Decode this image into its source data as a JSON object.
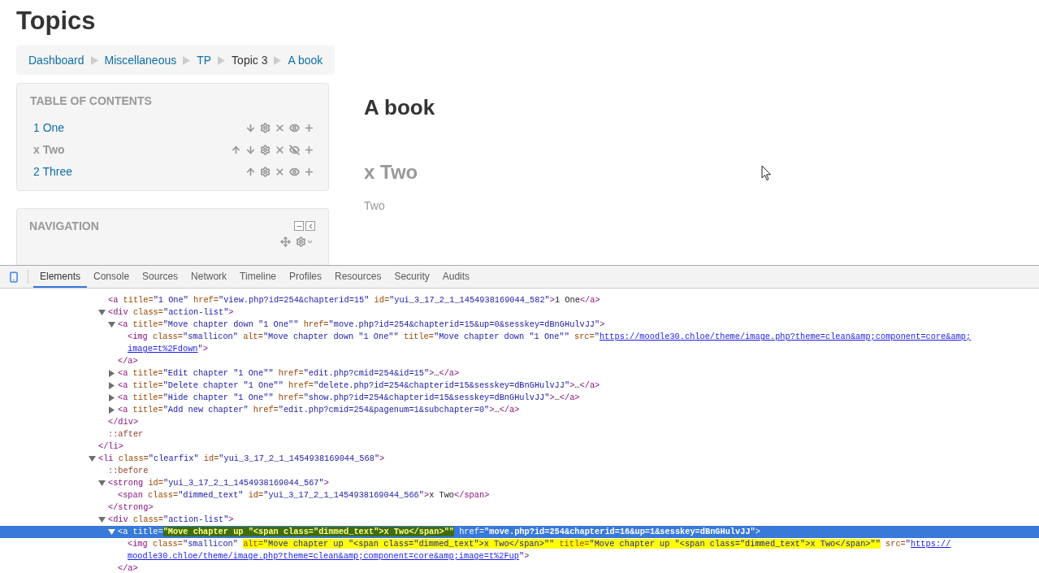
{
  "page": {
    "title": "Topics"
  },
  "breadcrumb": [
    {
      "label": "Dashboard",
      "link": true
    },
    {
      "label": "Miscellaneous",
      "link": true
    },
    {
      "label": "TP",
      "link": true
    },
    {
      "label": "Topic 3",
      "link": false
    },
    {
      "label": "A book",
      "link": true
    }
  ],
  "toc": {
    "title": "TABLE OF CONTENTS",
    "items": [
      {
        "label": "1 One",
        "hidden": false,
        "actions": [
          {
            "kind": "down"
          },
          {
            "kind": "edit"
          },
          {
            "kind": "delete"
          },
          {
            "kind": "hide"
          },
          {
            "kind": "add"
          }
        ]
      },
      {
        "label": "x Two",
        "hidden": true,
        "actions": [
          {
            "kind": "up"
          },
          {
            "kind": "down"
          },
          {
            "kind": "edit"
          },
          {
            "kind": "delete"
          },
          {
            "kind": "show"
          },
          {
            "kind": "add"
          }
        ]
      },
      {
        "label": "2 Three",
        "hidden": false,
        "actions": [
          {
            "kind": "up"
          },
          {
            "kind": "edit"
          },
          {
            "kind": "delete"
          },
          {
            "kind": "hide"
          },
          {
            "kind": "add"
          }
        ]
      }
    ]
  },
  "navigation": {
    "title": "NAVIGATION"
  },
  "content": {
    "book_title": "A book",
    "chapter_title": "x Two",
    "chapter_text": "Two"
  },
  "devtools": {
    "tabs": [
      {
        "label": "Elements",
        "selected": true
      },
      {
        "label": "Console",
        "selected": false
      },
      {
        "label": "Sources",
        "selected": false
      },
      {
        "label": "Network",
        "selected": false
      },
      {
        "label": "Timeline",
        "selected": false
      },
      {
        "label": "Profiles",
        "selected": false
      },
      {
        "label": "Resources",
        "selected": false
      },
      {
        "label": "Security",
        "selected": false
      },
      {
        "label": "Audits",
        "selected": false
      }
    ],
    "dom": [
      {
        "children": [
          {
            "selected": false,
            "tokens": [
              {
                "kind": "tag",
                "text": "<a"
              },
              {
                "kind": "attr",
                "text": " title="
              },
              {
                "kind": "value",
                "text": "\"1 One\""
              },
              {
                "kind": "attr",
                "text": " href="
              },
              {
                "kind": "value",
                "text": "\"view.php?id=254&chapterid=15\""
              },
              {
                "kind": "attr",
                "text": " id="
              },
              {
                "kind": "value",
                "text": "\"yui_3_17_2_1_1454938169044_582\""
              },
              {
                "kind": "tag",
                "text": ">"
              },
              {
                "kind": "text",
                "text": "1 One"
              },
              {
                "kind": "tag",
                "text": "</a>"
              }
            ]
          },
          {
            "selected": false,
            "expanded": true,
            "tokens": [
              {
                "kind": "tag",
                "text": "<div"
              },
              {
                "kind": "attr",
                "text": " class="
              },
              {
                "kind": "value",
                "text": "\"action-list\""
              },
              {
                "kind": "tag",
                "text": ">"
              }
            ],
            "children": [
              {
                "selected": false,
                "expanded": true,
                "tokens": [
                  {
                    "kind": "tag",
                    "text": "<a"
                  },
                  {
                    "kind": "attr",
                    "text": " title="
                  },
                  {
                    "kind": "value",
                    "text": "\"Move chapter down \"1 One\"\""
                  },
                  {
                    "kind": "attr",
                    "text": " href="
                  },
                  {
                    "kind": "value",
                    "text": "\"move.php?id=254&chapterid=15&up=0&sesskey=dBnGHulvJJ\""
                  },
                  {
                    "kind": "tag",
                    "text": ">"
                  }
                ],
                "children": [
                  {
                    "selected": false,
                    "tokens": [
                      {
                        "kind": "tag",
                        "text": "<img"
                      },
                      {
                        "kind": "attr",
                        "text": " class="
                      },
                      {
                        "kind": "value",
                        "text": "\"smallicon\""
                      },
                      {
                        "kind": "attr",
                        "text": " alt="
                      },
                      {
                        "kind": "value",
                        "text": "\"Move chapter down \"1 One\"\""
                      },
                      {
                        "kind": "attr",
                        "text": " title="
                      },
                      {
                        "kind": "value",
                        "text": "\"Move chapter down \"1 One\"\""
                      },
                      {
                        "kind": "attr",
                        "text": " src="
                      },
                      {
                        "kind": "value",
                        "text": "\""
                      },
                      {
                        "kind": "link",
                        "text": "https://moodle30.chloe/theme/image.php?theme=clean&amp;component=core&amp;"
                      },
                      {
                        "kind": "break"
                      },
                      {
                        "kind": "link",
                        "text": "image=t%2Fdown"
                      },
                      {
                        "kind": "value",
                        "text": "\""
                      },
                      {
                        "kind": "tag",
                        "text": ">"
                      }
                    ]
                  }
                ],
                "close": [
                  {
                    "kind": "tag",
                    "text": "</a>"
                  }
                ]
              },
              {
                "selected": false,
                "expanded": false,
                "tokens": [
                  {
                    "kind": "tag",
                    "text": "<a"
                  },
                  {
                    "kind": "attr",
                    "text": " title="
                  },
                  {
                    "kind": "value",
                    "text": "\"Edit chapter \"1 One\"\""
                  },
                  {
                    "kind": "attr",
                    "text": " href="
                  },
                  {
                    "kind": "value",
                    "text": "\"edit.php?cmid=254&id=15\""
                  },
                  {
                    "kind": "tag",
                    "text": ">"
                  },
                  {
                    "kind": "text",
                    "text": "…"
                  },
                  {
                    "kind": "tag",
                    "text": "</a>"
                  }
                ]
              },
              {
                "selected": false,
                "expanded": false,
                "tokens": [
                  {
                    "kind": "tag",
                    "text": "<a"
                  },
                  {
                    "kind": "attr",
                    "text": " title="
                  },
                  {
                    "kind": "value",
                    "text": "\"Delete chapter \"1 One\"\""
                  },
                  {
                    "kind": "attr",
                    "text": " href="
                  },
                  {
                    "kind": "value",
                    "text": "\"delete.php?id=254&chapterid=15&sesskey=dBnGHulvJJ\""
                  },
                  {
                    "kind": "tag",
                    "text": ">"
                  },
                  {
                    "kind": "text",
                    "text": "…"
                  },
                  {
                    "kind": "tag",
                    "text": "</a>"
                  }
                ]
              },
              {
                "selected": false,
                "expanded": false,
                "tokens": [
                  {
                    "kind": "tag",
                    "text": "<a"
                  },
                  {
                    "kind": "attr",
                    "text": " title="
                  },
                  {
                    "kind": "value",
                    "text": "\"Hide chapter \"1 One\"\""
                  },
                  {
                    "kind": "attr",
                    "text": " href="
                  },
                  {
                    "kind": "value",
                    "text": "\"show.php?id=254&chapterid=15&sesskey=dBnGHulvJJ\""
                  },
                  {
                    "kind": "tag",
                    "text": ">"
                  },
                  {
                    "kind": "text",
                    "text": "…"
                  },
                  {
                    "kind": "tag",
                    "text": "</a>"
                  }
                ]
              },
              {
                "selected": false,
                "expanded": false,
                "tokens": [
                  {
                    "kind": "tag",
                    "text": "<a"
                  },
                  {
                    "kind": "attr",
                    "text": " title="
                  },
                  {
                    "kind": "value",
                    "text": "\"Add new chapter\""
                  },
                  {
                    "kind": "attr",
                    "text": " href="
                  },
                  {
                    "kind": "value",
                    "text": "\"edit.php?cmid=254&pagenum=1&subchapter=0\""
                  },
                  {
                    "kind": "tag",
                    "text": ">"
                  },
                  {
                    "kind": "text",
                    "text": "…"
                  },
                  {
                    "kind": "tag",
                    "text": "</a>"
                  }
                ]
              }
            ],
            "close": [
              {
                "kind": "tag",
                "text": "</div>"
              }
            ]
          },
          {
            "selected": false,
            "tokens": [
              {
                "kind": "pseudo",
                "text": "::after"
              }
            ]
          }
        ],
        "close": [
          {
            "kind": "tag",
            "text": "</li>"
          }
        ]
      },
      {
        "selected": false,
        "expanded": true,
        "tokens": [
          {
            "kind": "tag",
            "text": "<li"
          },
          {
            "kind": "attr",
            "text": " class="
          },
          {
            "kind": "value",
            "text": "\"clearfix\""
          },
          {
            "kind": "attr",
            "text": " id="
          },
          {
            "kind": "value",
            "text": "\"yui_3_17_2_1_1454938169044_568\""
          },
          {
            "kind": "tag",
            "text": ">"
          }
        ],
        "children": [
          {
            "selected": false,
            "tokens": [
              {
                "kind": "pseudo",
                "text": "::before"
              }
            ]
          },
          {
            "selected": false,
            "expanded": true,
            "tokens": [
              {
                "kind": "tag",
                "text": "<strong"
              },
              {
                "kind": "attr",
                "text": " id="
              },
              {
                "kind": "value",
                "text": "\"yui_3_17_2_1_1454938169044_567\""
              },
              {
                "kind": "tag",
                "text": ">"
              }
            ],
            "children": [
              {
                "selected": false,
                "tokens": [
                  {
                    "kind": "tag",
                    "text": "<span"
                  },
                  {
                    "kind": "attr",
                    "text": " class="
                  },
                  {
                    "kind": "value",
                    "text": "\"dimmed_text\""
                  },
                  {
                    "kind": "attr",
                    "text": " id="
                  },
                  {
                    "kind": "value",
                    "text": "\"yui_3_17_2_1_1454938169044_566\""
                  },
                  {
                    "kind": "tag",
                    "text": ">"
                  },
                  {
                    "kind": "text",
                    "text": "x Two"
                  },
                  {
                    "kind": "tag",
                    "text": "</span>"
                  }
                ]
              }
            ],
            "close": [
              {
                "kind": "tag",
                "text": "</strong>"
              }
            ]
          },
          {
            "selected": false,
            "expanded": true,
            "tokens": [
              {
                "kind": "tag",
                "text": "<div"
              },
              {
                "kind": "attr",
                "text": " class="
              },
              {
                "kind": "value",
                "text": "\"action-list\""
              },
              {
                "kind": "tag",
                "text": ">"
              }
            ],
            "children": [
              {
                "selected": true,
                "expanded": true,
                "tokens": [
                  {
                    "kind": "tag",
                    "text": "<a"
                  },
                  {
                    "kind": "attr",
                    "text": " title="
                  },
                  {
                    "kind": "marked-value",
                    "text": "\"Move chapter up \"<span class=\"dimmed_text\">x Two</span>\"\""
                  },
                  {
                    "kind": "attr",
                    "text": " href="
                  },
                  {
                    "kind": "value",
                    "text": "\"move.php?id=254&chapterid=16&up=1&sesskey=dBnGHulvJJ\""
                  },
                  {
                    "kind": "tag",
                    "text": ">"
                  }
                ],
                "children": [
                  {
                    "selected": false,
                    "tokens": [
                      {
                        "kind": "tag",
                        "text": "<img"
                      },
                      {
                        "kind": "attr",
                        "text": " class="
                      },
                      {
                        "kind": "value",
                        "text": "\"smallicon\" "
                      },
                      {
                        "kind": "marked-attr",
                        "text": "alt="
                      },
                      {
                        "kind": "marked-value",
                        "text": "\"Move chapter up \"<span class=\"dimmed_text\">x Two</span>\"\" "
                      },
                      {
                        "kind": "marked-attr",
                        "text": "title="
                      },
                      {
                        "kind": "marked-value",
                        "text": "\"Move chapter up \"<span class=\"dimmed_text\">x Two</span>\"\""
                      },
                      {
                        "kind": "attr",
                        "text": " src="
                      },
                      {
                        "kind": "value",
                        "text": "\""
                      },
                      {
                        "kind": "link",
                        "text": "https://"
                      },
                      {
                        "kind": "break"
                      },
                      {
                        "kind": "link",
                        "text": "moodle30.chloe/theme/image.php?theme=clean&amp;component=core&amp;image=t%2Fup"
                      },
                      {
                        "kind": "value",
                        "text": "\""
                      },
                      {
                        "kind": "tag",
                        "text": ">"
                      }
                    ]
                  }
                ],
                "close": [
                  {
                    "kind": "tag",
                    "text": "</a>"
                  }
                ]
              }
            ]
          }
        ]
      }
    ]
  }
}
